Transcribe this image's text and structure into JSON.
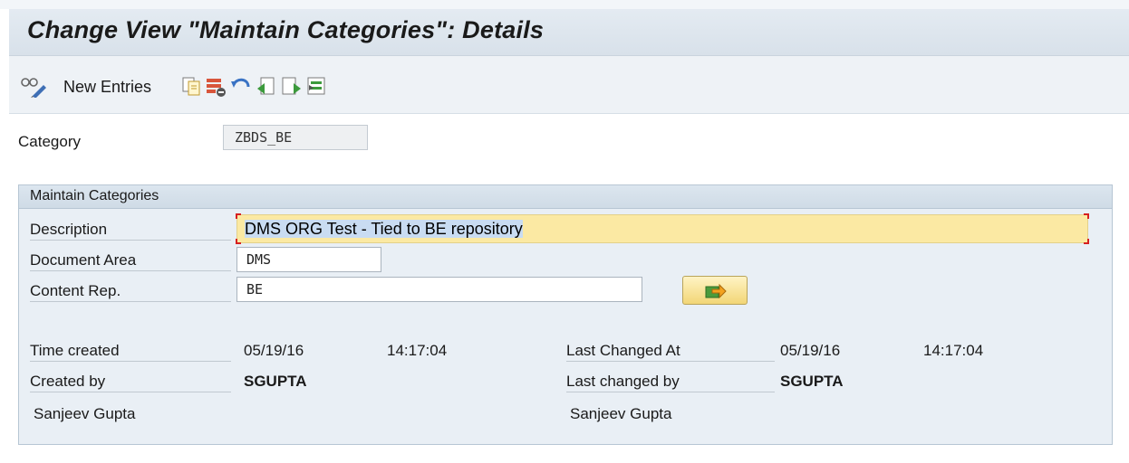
{
  "window": {
    "title": "Change View \"Maintain Categories\": Details"
  },
  "toolbar": {
    "new_entries_label": "New Entries",
    "icons": [
      "glasses-edit-icon",
      "copy-icon",
      "delete-icon",
      "undo-icon",
      "previous-entry-icon",
      "next-entry-icon",
      "select-block-icon"
    ]
  },
  "header_fields": {
    "category_label": "Category",
    "category_value": "ZBDS_BE"
  },
  "group": {
    "title": "Maintain Categories",
    "description_label": "Description",
    "description_value": "DMS ORG Test - Tied to BE repository",
    "document_area_label": "Document Area",
    "document_area_value": "DMS",
    "content_rep_label": "Content Rep.",
    "content_rep_value": "BE",
    "time_created_label": "Time created",
    "created_date": "05/19/16",
    "created_time": "14:17:04",
    "created_by_label": "Created by",
    "created_by_user": "SGUPTA",
    "created_by_name": "Sanjeev Gupta",
    "last_changed_at_label": "Last Changed At",
    "changed_date": "05/19/16",
    "changed_time": "14:17:04",
    "last_changed_by_label": "Last changed by",
    "changed_by_user": "SGUPTA",
    "changed_by_name": "Sanjeev Gupta"
  },
  "colors": {
    "title_bar": "#dde5ed",
    "group_background": "#e9eff5",
    "description_highlight": "#fbe9a3",
    "focus_marker": "#d62020"
  }
}
